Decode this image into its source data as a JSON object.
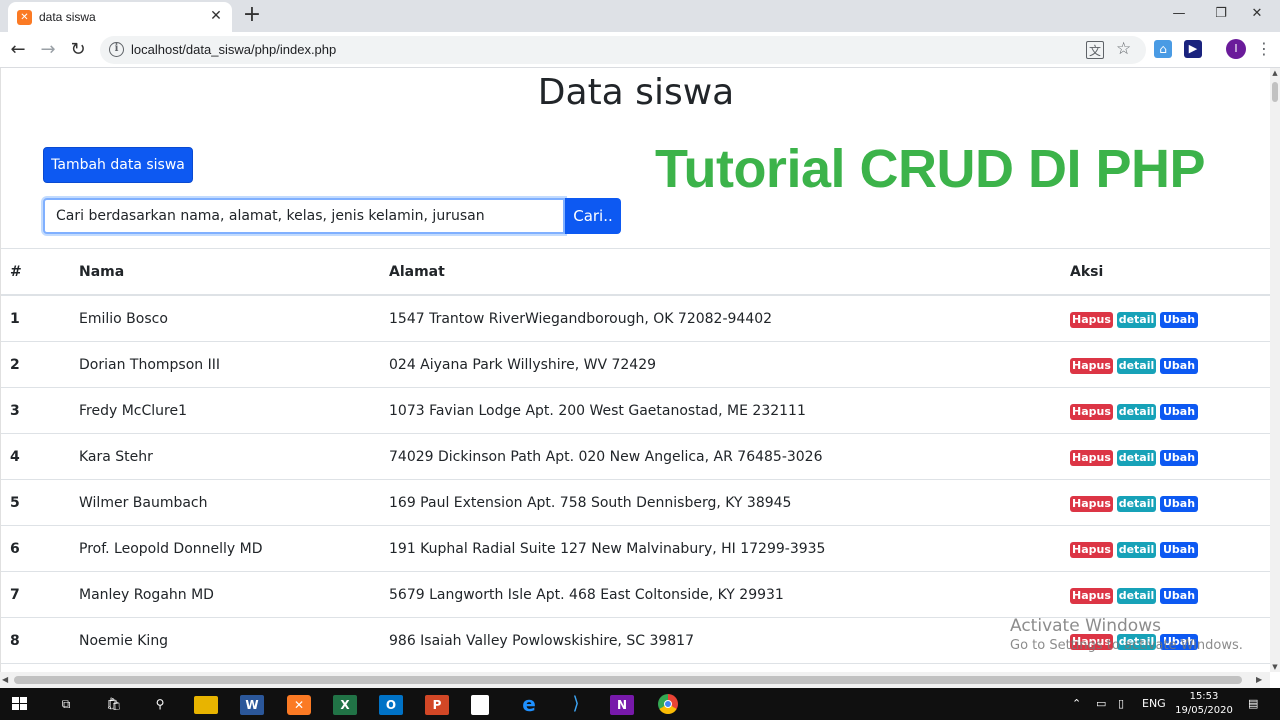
{
  "browser": {
    "tab_title": "data siswa",
    "new_tab_symbol": "+",
    "url": "localhost/data_siswa/php/index.php",
    "window_controls": {
      "minimize": "—",
      "maximize": "❐",
      "close": "✕"
    },
    "profile_initial": "I"
  },
  "page": {
    "title": "Data siswa",
    "add_button_label": "Tambah data siswa",
    "overlay_title": "Tutorial CRUD DI PHP",
    "search": {
      "placeholder": "Cari berdasarkan nama, alamat, kelas, jenis kelamin, jurusan",
      "button_label": "Cari.."
    }
  },
  "table": {
    "headers": {
      "num": "#",
      "nama": "Nama",
      "alamat": "Alamat",
      "aksi": "Aksi"
    },
    "action_labels": {
      "hapus": "Hapus",
      "detail": "detail",
      "ubah": "Ubah"
    },
    "rows": [
      {
        "num": "1",
        "nama": "Emilio Bosco",
        "alamat": "1547 Trantow RiverWiegandborough, OK 72082-94402"
      },
      {
        "num": "2",
        "nama": "Dorian Thompson III",
        "alamat": "024 Aiyana Park Willyshire, WV 72429"
      },
      {
        "num": "3",
        "nama": "Fredy McClure1",
        "alamat": "1073 Favian Lodge Apt. 200 West Gaetanostad, ME 232111"
      },
      {
        "num": "4",
        "nama": "Kara Stehr",
        "alamat": "74029 Dickinson Path Apt. 020 New Angelica, AR 76485-3026"
      },
      {
        "num": "5",
        "nama": "Wilmer Baumbach",
        "alamat": "169 Paul Extension Apt. 758 South Dennisberg, KY 38945"
      },
      {
        "num": "6",
        "nama": "Prof. Leopold Donnelly MD",
        "alamat": "191 Kuphal Radial Suite 127 New Malvinabury, HI 17299-3935"
      },
      {
        "num": "7",
        "nama": "Manley Rogahn MD",
        "alamat": "5679 Langworth Isle Apt. 468 East Coltonside, KY 29931"
      },
      {
        "num": "8",
        "nama": "Noemie King",
        "alamat": "986 Isaiah Valley Powlowskishire, SC 39817"
      }
    ]
  },
  "windows_activation": {
    "title": "Activate Windows",
    "subtitle": "Go to Settings to activate Windows."
  },
  "taskbar": {
    "language": "ENG",
    "time": "15:53",
    "date": "19/05/2020"
  },
  "colors": {
    "primary": "#0d59f2",
    "danger": "#dc3545",
    "info": "#17a2b8",
    "overlay_green": "#3cb34a"
  }
}
